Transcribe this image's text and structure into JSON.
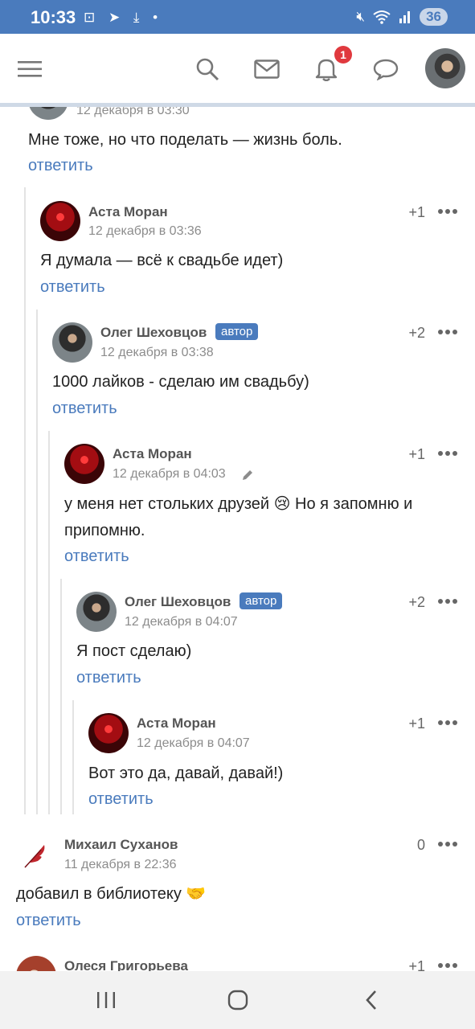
{
  "status_bar": {
    "time": "10:33",
    "left_icons": "⊡ ➤ ⤓ •",
    "battery": "36",
    "icons": [
      "screenshot-icon",
      "telegram-icon",
      "download-icon",
      "mute-icon",
      "wifi-icon",
      "signal-icon",
      "battery-icon"
    ]
  },
  "topbar": {
    "notification_count": "1",
    "icons": [
      "menu-icon",
      "search-icon",
      "mail-icon",
      "bell-icon",
      "chat-icon",
      "profile-avatar"
    ]
  },
  "comments": [
    {
      "id": "c0",
      "name": "",
      "date": "12 декабря в 03:30",
      "text": "Мне тоже, но что поделать — жизнь боль.",
      "reply": "ответить"
    },
    {
      "id": "c1",
      "name": "Аста Моран",
      "date": "12 декабря в 03:36",
      "score": "+1",
      "text": "Я думала — всё к свадьбе идет)",
      "reply": "ответить"
    },
    {
      "id": "c2",
      "name": "Олег Шеховцов",
      "badge": "автор",
      "date": "12 декабря в 03:38",
      "score": "+2",
      "text": "1000 лайков - сделаю им свадьбу)",
      "reply": "ответить"
    },
    {
      "id": "c3",
      "name": "Аста Моран",
      "date": "12 декабря в 04:03",
      "score": "+1",
      "text": "у меня нет стольких друзей 😢 Но я запомню и припомню.",
      "reply": "ответить"
    },
    {
      "id": "c4",
      "name": "Олег Шеховцов",
      "badge": "автор",
      "date": "12 декабря в 04:07",
      "score": "+2",
      "text": "Я пост сделаю)",
      "reply": "ответить"
    },
    {
      "id": "c5",
      "name": "Аста Моран",
      "date": "12 декабря в 04:07",
      "score": "+1",
      "text": "Вот это да, давай, давай!)",
      "reply": "ответить"
    },
    {
      "id": "c6",
      "name": "Михаил Суханов",
      "date": "11 декабря в 22:36",
      "score": "0",
      "text": "добавил в библиотеку 🤝",
      "reply": "ответить"
    },
    {
      "id": "c7",
      "name": "Олеся Григорьева",
      "score": "+1"
    }
  ],
  "colors": {
    "status_bar": "#4a7bbd",
    "link": "#4a7bbd",
    "badge": "#e0393e",
    "author_badge": "#4a7bbd"
  }
}
